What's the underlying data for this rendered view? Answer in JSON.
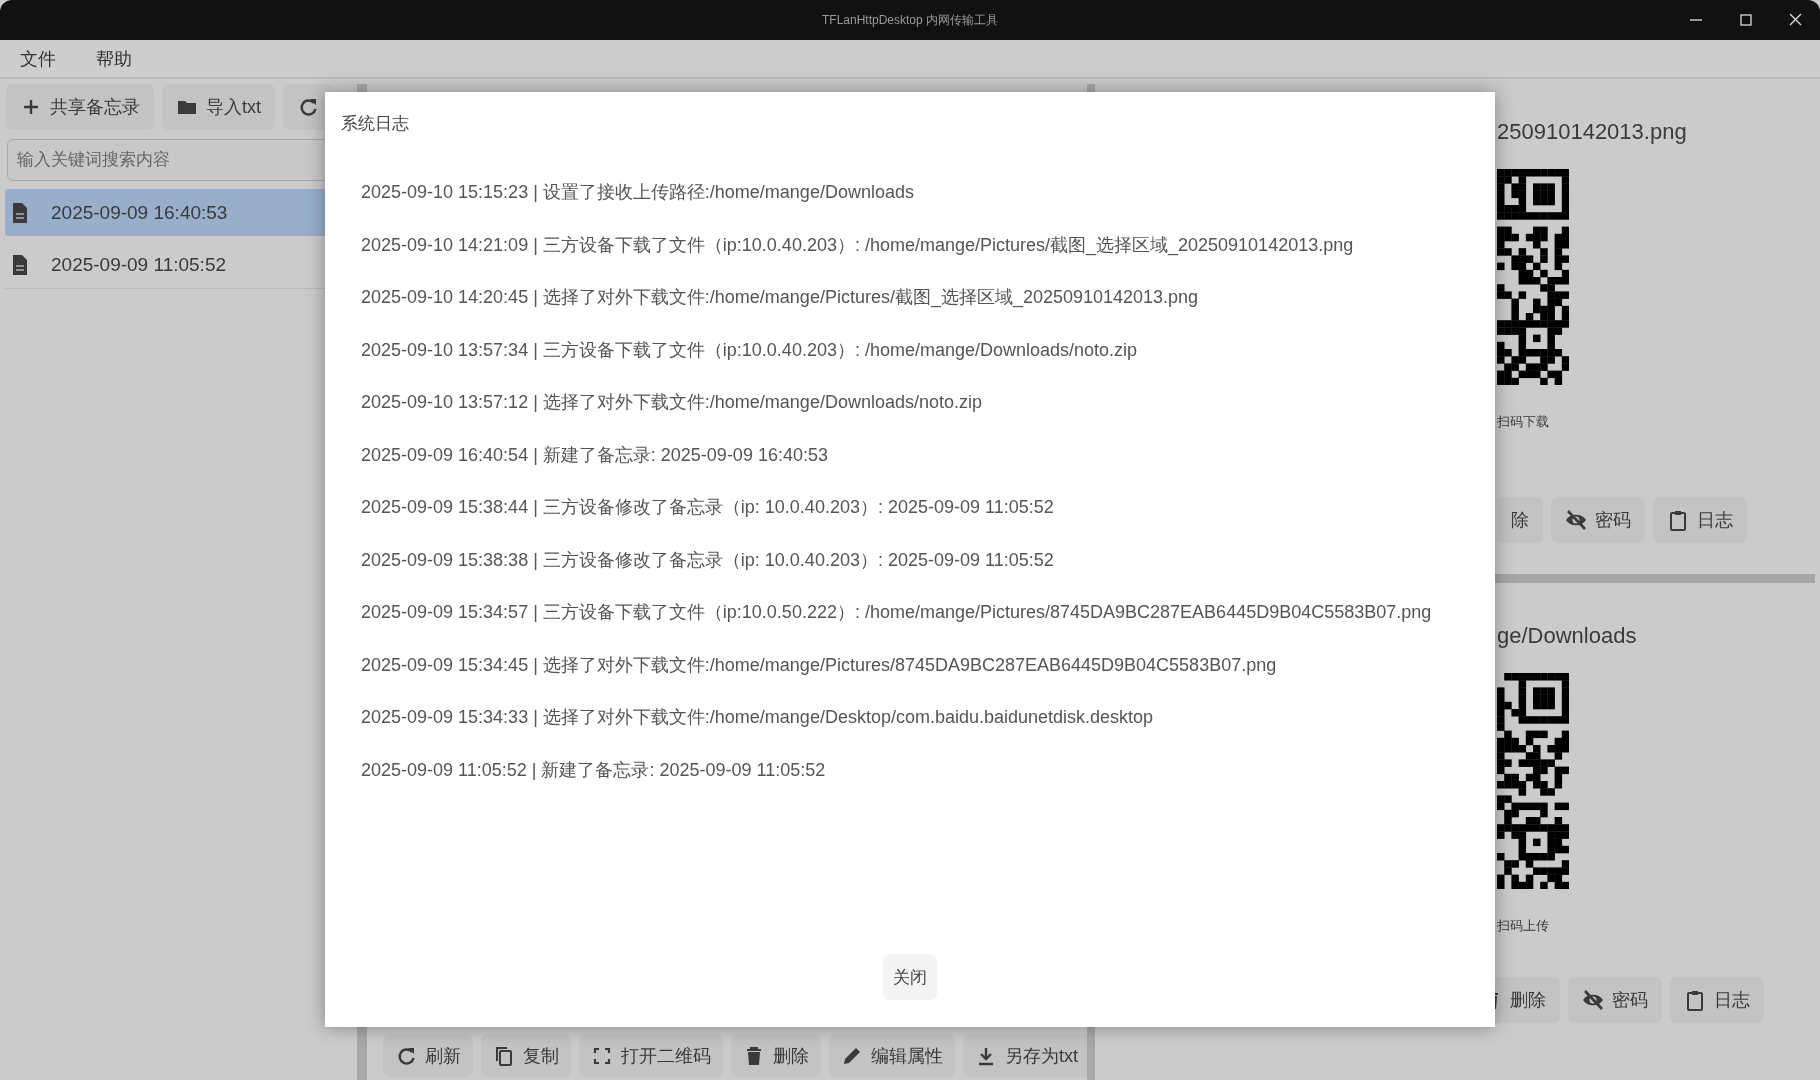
{
  "window": {
    "title": "TFLanHttpDesktop 内网传输工具"
  },
  "menu": [
    {
      "label": "文件"
    },
    {
      "label": "帮助"
    }
  ],
  "left_toolbar": [
    {
      "kind": "plus",
      "label": "共享备忘录"
    },
    {
      "kind": "folder",
      "label": "导入txt"
    },
    {
      "kind": "refresh"
    }
  ],
  "search": {
    "placeholder": "输入关键词搜索内容"
  },
  "memos": [
    {
      "title": "2025-09-09 16:40:53",
      "selected": true
    },
    {
      "title": "2025-09-09 11:05:52",
      "selected": false
    }
  ],
  "editor_toolbar": [
    {
      "kind": "refresh",
      "label": "刷新"
    },
    {
      "kind": "copy",
      "label": "复制"
    },
    {
      "kind": "scan",
      "label": "打开二维码"
    },
    {
      "kind": "trash",
      "label": "删除"
    },
    {
      "kind": "pencil",
      "label": "编辑属性"
    },
    {
      "kind": "download",
      "label": "另存为txt"
    }
  ],
  "download_panel": {
    "path": "250910142013.png",
    "caption": "扫码下载",
    "buttons": [
      {
        "kind": "text",
        "label": "除"
      },
      {
        "kind": "eye-off",
        "label": "密码"
      },
      {
        "kind": "clipboard",
        "label": "日志"
      }
    ]
  },
  "upload_panel": {
    "path": "ge/Downloads",
    "caption": "扫码上传",
    "buttons": [
      {
        "kind": "covered"
      },
      {
        "kind": "covered"
      },
      {
        "kind": "trash",
        "label": "删除"
      },
      {
        "kind": "eye-off",
        "label": "密码"
      },
      {
        "kind": "clipboard",
        "label": "日志"
      }
    ]
  },
  "dialog": {
    "title": "系统日志",
    "entries": [
      "2025-09-10 15:15:23 | 设置了接收上传路径:/home/mange/Downloads",
      "2025-09-10 14:21:09 | 三方设备下载了文件（ip:10.0.40.203）: /home/mange/Pictures/截图_选择区域_20250910142013.png",
      "2025-09-10 14:20:45 | 选择了对外下载文件:/home/mange/Pictures/截图_选择区域_20250910142013.png",
      "2025-09-10 13:57:34 | 三方设备下载了文件（ip:10.0.40.203）: /home/mange/Downloads/noto.zip",
      "2025-09-10 13:57:12 | 选择了对外下载文件:/home/mange/Downloads/noto.zip",
      "2025-09-09 16:40:54 | 新建了备忘录: 2025-09-09 16:40:53",
      "2025-09-09 15:38:44 | 三方设备修改了备忘录（ip: 10.0.40.203）: 2025-09-09 11:05:52",
      "2025-09-09 15:38:38 | 三方设备修改了备忘录（ip: 10.0.40.203）: 2025-09-09 11:05:52",
      "2025-09-09 15:34:57 | 三方设备下载了文件（ip:10.0.50.222）: /home/mange/Pictures/8745DA9BC287EAB6445D9B04C5583B07.png",
      "2025-09-09 15:34:45 | 选择了对外下载文件:/home/mange/Pictures/8745DA9BC287EAB6445D9B04C5583B07.png",
      "2025-09-09 15:34:33 | 选择了对外下载文件:/home/mange/Desktop/com.baidu.baidunetdisk.desktop",
      "2025-09-09 11:05:52 | 新建了备忘录: 2025-09-09 11:05:52"
    ],
    "close_button": "关闭"
  }
}
